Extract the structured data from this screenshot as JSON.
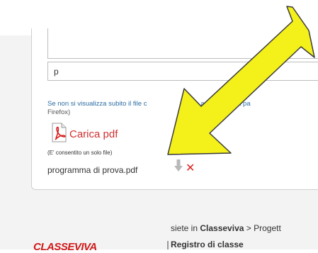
{
  "upload_form": {
    "text_field_value": "p",
    "notice_line1": "Se non si visualizza subito il file c",
    "notice_line1_end": "e a ricaricare la pa",
    "notice_line2": "Firefox)",
    "upload_label": "Carica pdf",
    "one_file_note": "(E' consentito un solo file)",
    "attached_file": "programma di prova.pdf"
  },
  "footer": {
    "breadcrumb_prefix": "siete in ",
    "breadcrumb_site": "Classeviva",
    "breadcrumb_rest": " > Progett",
    "logo_text": "CLASSEVIVA",
    "section_title": "Registro di classe"
  },
  "annotation": {
    "arrow_color": "#f4f01a",
    "arrow_outline": "#3a3a3a"
  },
  "icons": {
    "pdf": "pdf-file-icon",
    "download": "download-arrow-icon",
    "delete": "delete-x-icon"
  }
}
